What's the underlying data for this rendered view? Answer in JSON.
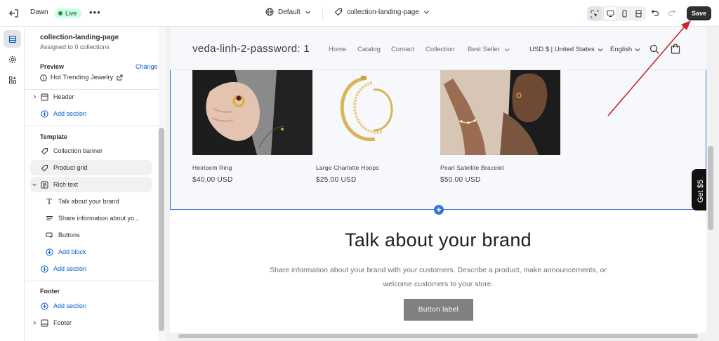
{
  "topbar": {
    "theme_name": "Dawn",
    "status": "Live",
    "more": "•••",
    "view": "Default",
    "template": "collection-landing-page",
    "save_label": "Save"
  },
  "sidebar": {
    "title": "collection-landing-page",
    "subtitle": "Assigned to 0 collections",
    "preview_label": "Preview",
    "change_label": "Change",
    "preview_value": "Hot Trending Jewelry",
    "header_item": "Header",
    "add_section": "Add section",
    "template_heading": "Template",
    "template_items": {
      "collection_banner": "Collection banner",
      "product_grid": "Product grid",
      "rich_text": "Rich text",
      "block_heading": "Talk about your brand",
      "block_text": "Share information about yo...",
      "block_buttons": "Buttons",
      "add_block": "Add block"
    },
    "footer_heading": "Footer",
    "footer_item": "Footer"
  },
  "store": {
    "name": "veda-linh-2-password: 1",
    "nav": [
      "Home",
      "Catalog",
      "Contact",
      "Collection",
      "Best Seller"
    ],
    "currency": "USD $ | United States",
    "language": "English",
    "products": [
      {
        "name": "Heirloom Ring",
        "price": "$40.00 USD"
      },
      {
        "name": "Large Charlotte Hoops",
        "price": "$25.00 USD"
      },
      {
        "name": "Pearl Satellite Bracelet",
        "price": "$50.00 USD"
      }
    ],
    "rich_text": {
      "heading": "Talk about your brand",
      "text": "Share information about your brand with your customers. Describe a product, make announcements, or welcome customers to your store.",
      "button": "Button label"
    },
    "popup_tab": "Get $5"
  },
  "colors": {
    "accent": "#005bd3",
    "selection": "#3b74d1",
    "save_bg": "#303030",
    "live_bg": "#cdfee1",
    "annotation_arrow": "#c8282d"
  }
}
